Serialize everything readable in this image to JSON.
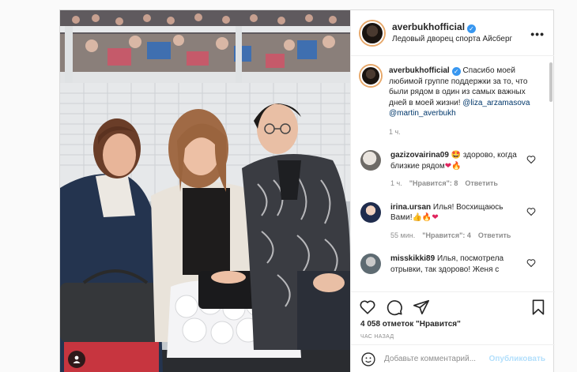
{
  "post": {
    "author": "averbukhofficial",
    "location": "Ледовый дворец спорта Айсберг",
    "more_label": "•••"
  },
  "caption": {
    "author": "averbukhofficial",
    "text": "Спасибо моей любимой группе поддержки за то, что были рядом в один из самых важных дней в моей жизни!",
    "mention1": "@liza_arzamasova",
    "mention2": "@martin_averbukh",
    "time": "1 ч."
  },
  "comments": [
    {
      "user": "gazizovairina09",
      "text": "🤩 здорово, когда близкие рядом",
      "emoji": "❤🔥",
      "time": "1 ч.",
      "likes": "\"Нравится\": 8",
      "reply": "Ответить"
    },
    {
      "user": "irina.ursan",
      "text": "Илья! Восхищаюсь Вами!",
      "emoji": "👍🔥❤",
      "time": "55 мин.",
      "likes": "\"Нравится\": 4",
      "reply": "Ответить"
    },
    {
      "user": "misskikki89",
      "text": "Илья, посмотрела отрывки, так здорово! Женя с",
      "emoji": "",
      "time": "",
      "likes": "",
      "reply": ""
    }
  ],
  "actions": {
    "likes": "4 058 отметок \"Нравится\"",
    "posted_ago": "ЧАС НАЗАД",
    "comment_placeholder": "Добавьте комментарий...",
    "publish": "Опубликовать"
  },
  "icons": {
    "like": "heart-icon",
    "comment": "comment-icon",
    "share": "share-icon",
    "save": "bookmark-icon",
    "emoji": "emoji-icon",
    "tag": "user-tag-icon",
    "more": "more-icon",
    "verified": "verified-badge-icon"
  },
  "colors": {
    "verified": "#3897f0",
    "mention": "#00376b",
    "publish": "#b2dffc",
    "muted": "#8e8e8e"
  }
}
